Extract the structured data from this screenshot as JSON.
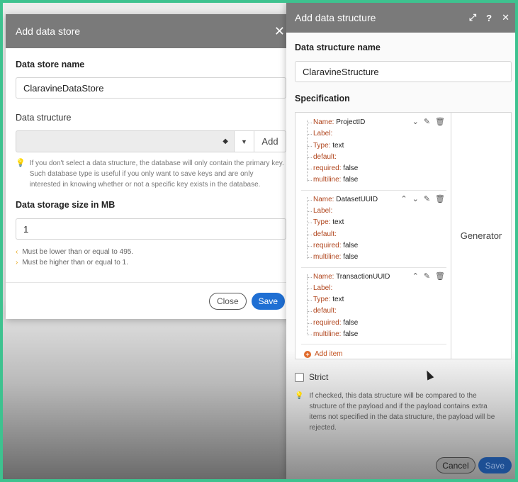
{
  "store_dialog": {
    "title": "Add data store",
    "name_label": "Data store name",
    "name_value": "ClaravineDataStore",
    "structure_label": "Data structure",
    "add_label": "Add",
    "structure_hint": "If you don't select a data structure, the database will only contain the primary key. Such database type is useful if you only want to save keys and are only interested in knowing whether or not a specific key exists in the database.",
    "size_label": "Data storage size in MB",
    "size_value": "1",
    "rule_max": "Must be lower than or equal to 495.",
    "rule_min": "Must be higher than or equal to 1.",
    "close_label": "Close",
    "save_label": "Save"
  },
  "struct_dialog": {
    "title": "Add data structure",
    "name_label": "Data structure name",
    "name_value": "ClaravineStructure",
    "spec_label": "Specification",
    "generator_label": "Generator",
    "add_item_label": "Add item",
    "strict_label": "Strict",
    "strict_hint": "If checked, this data structure will be compared to the structure of the payload and if the payload contains extra items not specified in the data structure, the payload will be rejected.",
    "close_label": "Cancel",
    "save_label": "Save",
    "prop_keys": {
      "name": "Name:",
      "label": "Label:",
      "type": "Type:",
      "default": "default:",
      "required": "required:",
      "multiline": "multiline:"
    },
    "items": [
      {
        "name": "ProjectID",
        "label": "",
        "type": "text",
        "default": "",
        "required": "false",
        "multiline": "false"
      },
      {
        "name": "DatasetUUID",
        "label": "",
        "type": "text",
        "default": "",
        "required": "false",
        "multiline": "false"
      },
      {
        "name": "TransactionUUID",
        "label": "",
        "type": "text",
        "default": "",
        "required": "false",
        "multiline": "false"
      }
    ]
  },
  "colors": {
    "accent_blue": "#1f6fd3",
    "header_gray": "#7a7a7a",
    "key_color": "#b0451d",
    "hint_bulb": "#e8a71c"
  }
}
